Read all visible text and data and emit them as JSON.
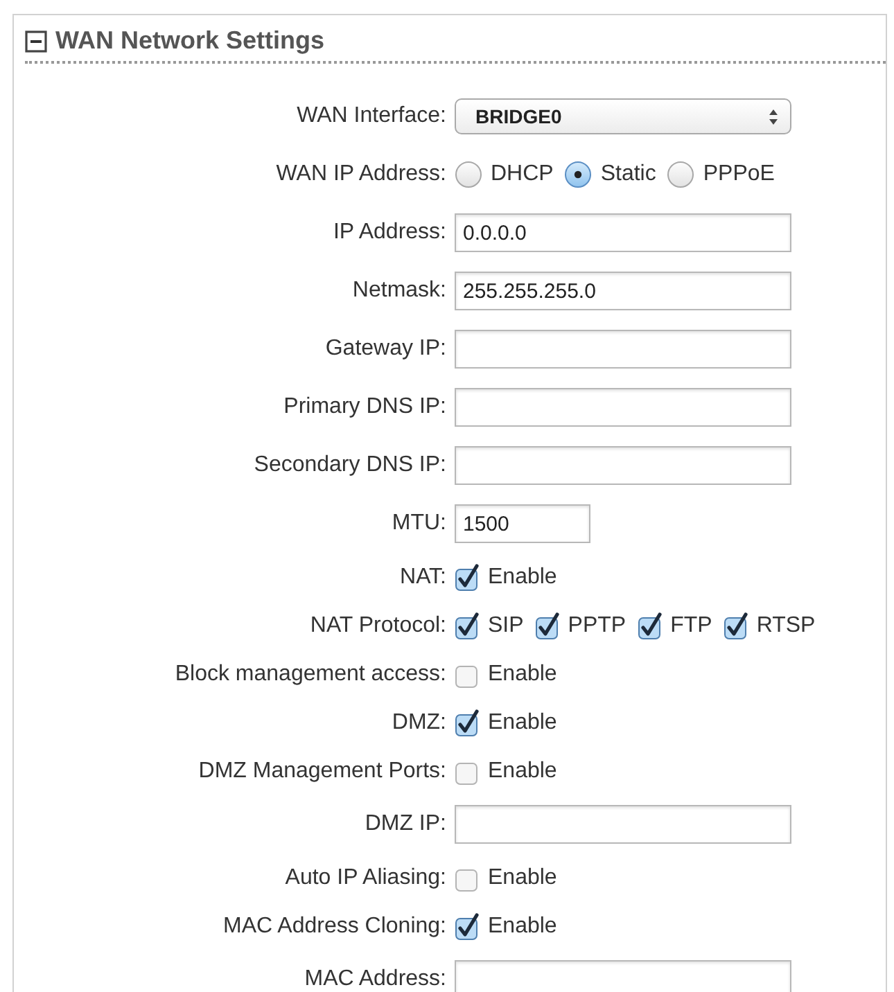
{
  "section": {
    "title": "WAN Network Settings",
    "expanded": true
  },
  "rows": [
    {
      "label": "WAN Interface:",
      "kind": "select",
      "value": "BRIDGE0"
    },
    {
      "label": "WAN IP Address:",
      "kind": "radio",
      "options": [
        {
          "label": "DHCP",
          "selected": false
        },
        {
          "label": "Static",
          "selected": true
        },
        {
          "label": "PPPoE",
          "selected": false
        }
      ]
    },
    {
      "label": "IP Address:",
      "kind": "text",
      "value": "0.0.0.0"
    },
    {
      "label": "Netmask:",
      "kind": "text",
      "value": "255.255.255.0"
    },
    {
      "label": "Gateway IP:",
      "kind": "text"
    },
    {
      "label": "Primary DNS IP:",
      "kind": "text"
    },
    {
      "label": "Secondary DNS IP:",
      "kind": "text"
    },
    {
      "label": "MTU:",
      "kind": "short-text",
      "value": "1500"
    },
    {
      "label": "NAT:",
      "kind": "checkbox",
      "options": [
        {
          "label": "Enable",
          "checked": true
        }
      ]
    },
    {
      "label": "NAT Protocol:",
      "kind": "checkbox",
      "options": [
        {
          "label": "SIP",
          "checked": true
        },
        {
          "label": "PPTP",
          "checked": true
        },
        {
          "label": "FTP",
          "checked": true
        },
        {
          "label": "RTSP",
          "checked": true
        }
      ]
    },
    {
      "label": "Block management access:",
      "kind": "checkbox",
      "options": [
        {
          "label": "Enable",
          "checked": false
        }
      ]
    },
    {
      "label": "DMZ:",
      "kind": "checkbox",
      "options": [
        {
          "label": "Enable",
          "checked": true
        }
      ]
    },
    {
      "label": "DMZ Management Ports:",
      "kind": "checkbox",
      "options": [
        {
          "label": "Enable",
          "checked": false
        }
      ]
    },
    {
      "label": "DMZ IP:",
      "kind": "text"
    },
    {
      "label": "Auto IP Aliasing:",
      "kind": "checkbox",
      "options": [
        {
          "label": "Enable",
          "checked": false
        }
      ]
    },
    {
      "label": "MAC Address Cloning:",
      "kind": "checkbox",
      "options": [
        {
          "label": "Enable",
          "checked": true
        }
      ]
    },
    {
      "label": "MAC Address:",
      "kind": "text"
    }
  ]
}
